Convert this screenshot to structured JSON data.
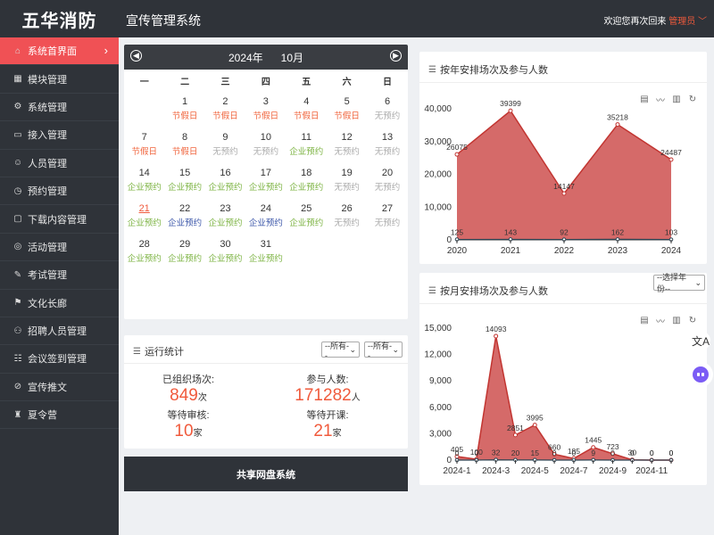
{
  "brand": "五华消防",
  "header": {
    "title": "宣传管理系统",
    "welcome": "欢迎您再次回来",
    "user": "管理员"
  },
  "sidebar": {
    "items": [
      {
        "label": "系统首界面",
        "icon": "home-icon"
      },
      {
        "label": "模块管理",
        "icon": "grid-icon"
      },
      {
        "label": "系统管理",
        "icon": "gear-icon"
      },
      {
        "label": "接入管理",
        "icon": "inbox-icon"
      },
      {
        "label": "人员管理",
        "icon": "user-icon"
      },
      {
        "label": "预约管理",
        "icon": "clock-icon"
      },
      {
        "label": "下载内容管理",
        "icon": "folder-icon"
      },
      {
        "label": "活动管理",
        "icon": "activity-icon"
      },
      {
        "label": "考试管理",
        "icon": "exam-icon"
      },
      {
        "label": "文化长廊",
        "icon": "flag-icon"
      },
      {
        "label": "招聘人员管理",
        "icon": "recruit-icon"
      },
      {
        "label": "会议签到管理",
        "icon": "meeting-icon"
      },
      {
        "label": "宣传推文",
        "icon": "leaf-icon"
      },
      {
        "label": "夏令营",
        "icon": "camp-icon"
      }
    ]
  },
  "calendar": {
    "year": "2024年",
    "month": "10月",
    "weekdays": [
      "一",
      "二",
      "三",
      "四",
      "五",
      "六",
      "日"
    ],
    "days": [
      {
        "n": "",
        "s": "",
        "t": ""
      },
      {
        "n": "1",
        "s": "节假日",
        "t": "holiday"
      },
      {
        "n": "2",
        "s": "节假日",
        "t": "holiday"
      },
      {
        "n": "3",
        "s": "节假日",
        "t": "holiday"
      },
      {
        "n": "4",
        "s": "节假日",
        "t": "holiday"
      },
      {
        "n": "5",
        "s": "节假日",
        "t": "holiday"
      },
      {
        "n": "6",
        "s": "无预约",
        "t": "none"
      },
      {
        "n": "7",
        "s": "节假日",
        "t": "holiday"
      },
      {
        "n": "8",
        "s": "节假日",
        "t": "holiday"
      },
      {
        "n": "9",
        "s": "无预约",
        "t": "none"
      },
      {
        "n": "10",
        "s": "无预约",
        "t": "none"
      },
      {
        "n": "11",
        "s": "企业预约",
        "t": "corp"
      },
      {
        "n": "12",
        "s": "无预约",
        "t": "none"
      },
      {
        "n": "13",
        "s": "无预约",
        "t": "none"
      },
      {
        "n": "14",
        "s": "企业预约",
        "t": "corp"
      },
      {
        "n": "15",
        "s": "企业预约",
        "t": "corp"
      },
      {
        "n": "16",
        "s": "企业预约",
        "t": "corp"
      },
      {
        "n": "17",
        "s": "企业预约",
        "t": "corp"
      },
      {
        "n": "18",
        "s": "企业预约",
        "t": "corp"
      },
      {
        "n": "19",
        "s": "无预约",
        "t": "none"
      },
      {
        "n": "20",
        "s": "无预约",
        "t": "none"
      },
      {
        "n": "21",
        "s": "企业预约",
        "t": "corp",
        "today": true
      },
      {
        "n": "22",
        "s": "企业预约",
        "t": "unit"
      },
      {
        "n": "23",
        "s": "企业预约",
        "t": "corp"
      },
      {
        "n": "24",
        "s": "企业预约",
        "t": "unit"
      },
      {
        "n": "25",
        "s": "企业预约",
        "t": "corp"
      },
      {
        "n": "26",
        "s": "无预约",
        "t": "none"
      },
      {
        "n": "27",
        "s": "无预约",
        "t": "none"
      },
      {
        "n": "28",
        "s": "企业预约",
        "t": "corp"
      },
      {
        "n": "29",
        "s": "企业预约",
        "t": "corp"
      },
      {
        "n": "30",
        "s": "企业预约",
        "t": "corp"
      },
      {
        "n": "31",
        "s": "企业预约",
        "t": "corp"
      }
    ]
  },
  "stats": {
    "title": "运行统计",
    "filter1": "--所有--",
    "filter2": "--所有--",
    "organized_label": "已组织场次:",
    "organized_value": "849",
    "organized_unit": "次",
    "participants_label": "参与人数:",
    "participants_value": "171282",
    "participants_unit": "人",
    "pending_label": "等待审核:",
    "pending_value": "10",
    "pending_unit": "家",
    "waiting_label": "等待开课:",
    "waiting_value": "21",
    "waiting_unit": "家"
  },
  "share_button": "共享网盘系统",
  "colors": {
    "accent": "#f05155",
    "sidebar": "#2f3339",
    "area": "#c9403f"
  },
  "chart_data": [
    {
      "type": "area",
      "title": "按年安排场次及参与人数",
      "categories": [
        "2020",
        "2021",
        "2022",
        "2023",
        "2024"
      ],
      "series": [
        {
          "values": [
            26075,
            39399,
            14147,
            35218,
            24487
          ]
        },
        {
          "values": [
            125,
            143,
            92,
            162,
            103
          ]
        }
      ],
      "ylim": [
        0,
        40000
      ],
      "yticks": [
        "0",
        "10,000",
        "20,000",
        "30,000",
        "40,000"
      ]
    },
    {
      "type": "area",
      "title": "按月安排场次及参与人数",
      "year_select": "--选择年份--",
      "categories": [
        "2024-1",
        "2024-2",
        "2024-3",
        "2024-4",
        "2024-5",
        "2024-6",
        "2024-7",
        "2024-8",
        "2024-9",
        "2024-10",
        "2024-11",
        "2024-12"
      ],
      "xticks": [
        "2024-1",
        "2024-3",
        "2024-5",
        "2024-7",
        "2024-9",
        "2024-11"
      ],
      "series": [
        {
          "values": [
            405,
            100,
            14093,
            2851,
            3995,
            660,
            185,
            1445,
            723,
            30,
            0,
            0
          ]
        },
        {
          "values": [
            0,
            0,
            32,
            20,
            15,
            0,
            0,
            9,
            0,
            0,
            0,
            0
          ]
        }
      ],
      "ylim": [
        0,
        15000
      ],
      "yticks": [
        "0",
        "3,000",
        "6,000",
        "9,000",
        "12,000",
        "15,000"
      ]
    }
  ]
}
